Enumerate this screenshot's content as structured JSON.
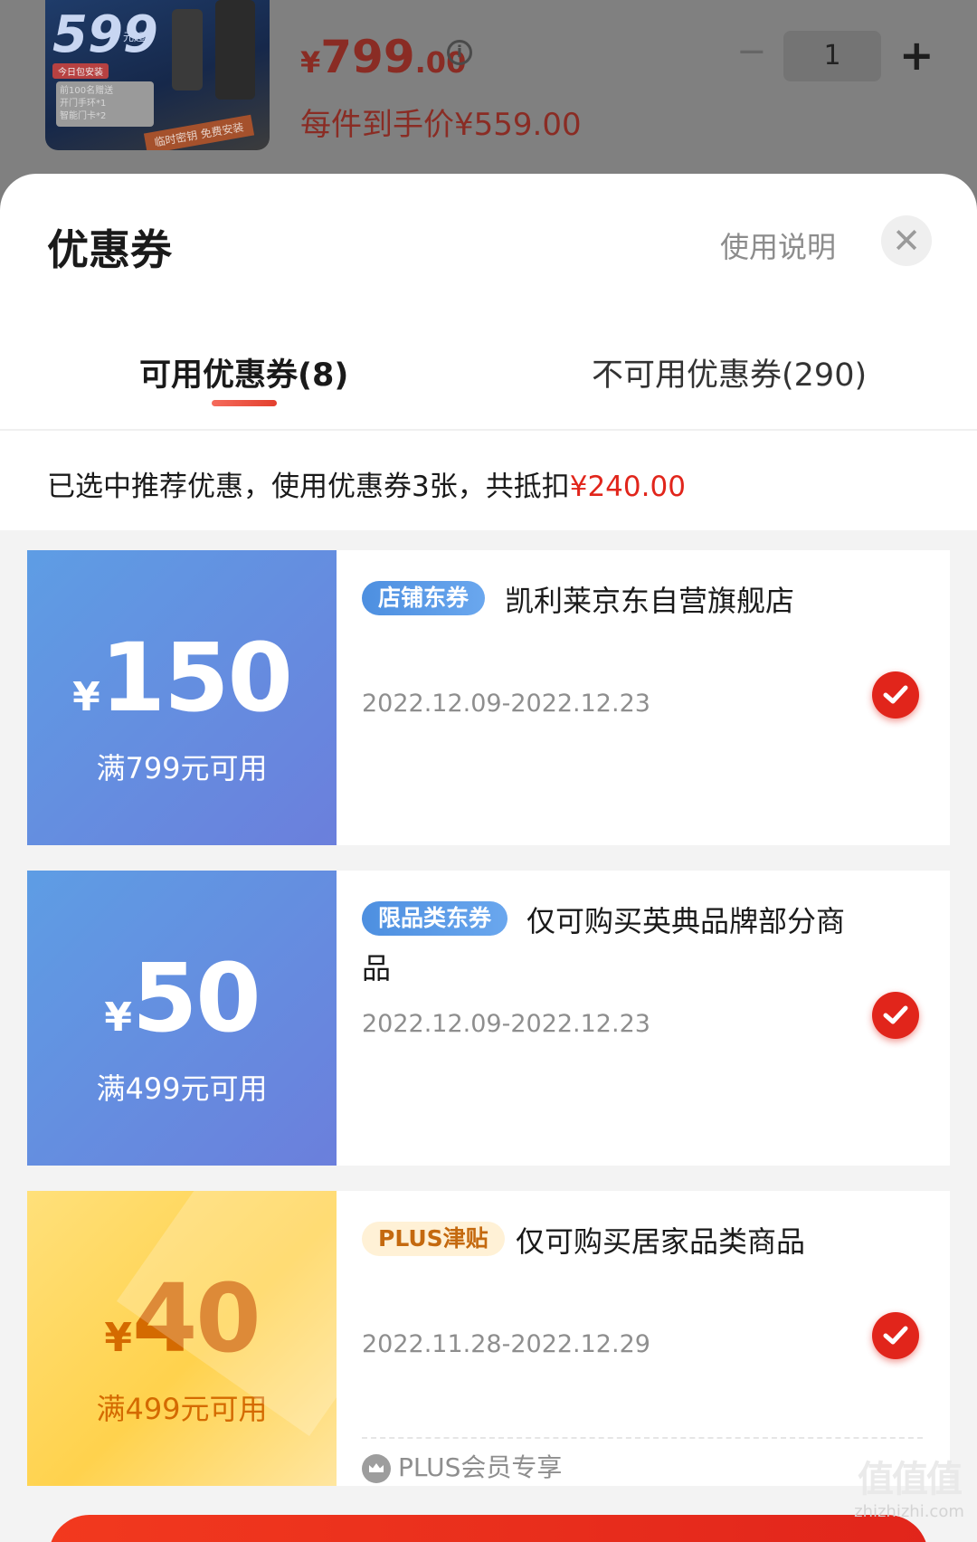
{
  "product": {
    "thumbnail": {
      "headline": "599",
      "unit": "元起",
      "badge": "今日包安装",
      "perks": [
        "前100名赠送",
        "开门手环*1",
        "智能门卡*2"
      ],
      "strip": "临时密钥 免费安装"
    },
    "price_currency": "¥",
    "price_integer": "799",
    "price_decimal": ".00",
    "price_each": "每件到手价¥559.00",
    "quantity": "1",
    "minus": "−",
    "plus": "+"
  },
  "sheet": {
    "title": "优惠券",
    "help": "使用说明",
    "close": "✕",
    "tabs": [
      {
        "label": "可用优惠券(8)",
        "active": true
      },
      {
        "label": "不可用优惠券(290)",
        "active": false
      }
    ],
    "summary_prefix": "已选中推荐优惠，使用优惠券3张，共抵扣",
    "summary_amount": "¥240.00"
  },
  "coupons": [
    {
      "currency": "¥",
      "amount": "150",
      "threshold": "满799元可用",
      "tag": "店铺东券",
      "name": "凯利莱京东自营旗舰店",
      "date": "2022.12.09-2022.12.23",
      "selected": true,
      "style": "blue"
    },
    {
      "currency": "¥",
      "amount": "50",
      "threshold": "满499元可用",
      "tag": "限品类东券",
      "name": "仅可购买英典品牌部分商品",
      "date": "2022.12.09-2022.12.23",
      "selected": true,
      "style": "blue"
    },
    {
      "currency": "¥",
      "amount": "40",
      "threshold": "满499元可用",
      "tag": "PLUS津贴",
      "name": "仅可购买居家品类商品",
      "date": "2022.11.28-2022.12.29",
      "selected": true,
      "style": "gold",
      "footer": "PLUS会员专享"
    }
  ],
  "watermark": {
    "logo": "值值值",
    "text": "zhizhizhi.com"
  },
  "colors": {
    "accent_red": "#e1251b",
    "blue_coupon": "#5e9de4",
    "gold_coupon": "#ffd24d"
  }
}
